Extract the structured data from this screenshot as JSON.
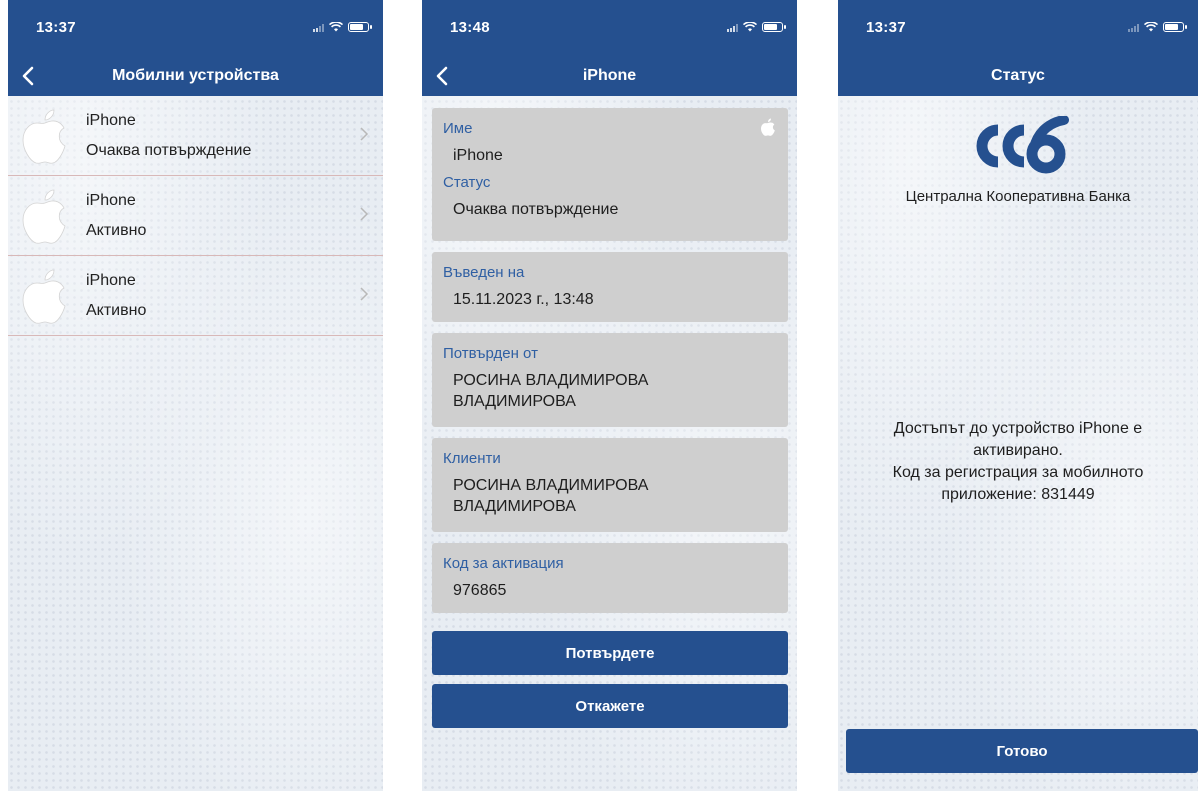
{
  "screen1": {
    "time": "13:37",
    "title": "Мобилни устройства",
    "devices": [
      {
        "name": "iPhone",
        "status": "Очаква потвърждение"
      },
      {
        "name": "iPhone",
        "status": "Активно"
      },
      {
        "name": "iPhone",
        "status": "Активно"
      }
    ]
  },
  "screen2": {
    "time": "13:48",
    "title": "iPhone",
    "fields": {
      "name_label": "Име",
      "name_value": "iPhone",
      "status_label": "Статус",
      "status_value": "Очаква потвърждение",
      "entered_label": "Въведен на",
      "entered_value": "15.11.2023 г., 13:48",
      "confirmed_label": "Потвърден от",
      "confirmed_value_line1": "РОСИНА ВЛАДИМИРОВА",
      "confirmed_value_line2": "ВЛАДИМИРОВА",
      "clients_label": "Клиенти",
      "clients_value_line1": "РОСИНА ВЛАДИМИРОВА",
      "clients_value_line2": "ВЛАДИМИРОВА",
      "code_label": "Код за активация",
      "code_value": "976865"
    },
    "confirm_button": "Потвърдете",
    "cancel_button": "Откажете"
  },
  "screen3": {
    "time": "13:37",
    "title": "Статус",
    "bank_name": "Централна Кооперативна Банка",
    "message_line1": "Достъпът до устройство iPhone е",
    "message_line2": "активирано.",
    "message_line3": "Код за регистрация за мобилното",
    "message_line4": "приложение: 831449",
    "done_button": "Готово"
  },
  "colors": {
    "header": "#25508f",
    "label_blue": "#2f5fa3",
    "card_gray": "#cfcfcf",
    "background": "#e8edf3"
  }
}
